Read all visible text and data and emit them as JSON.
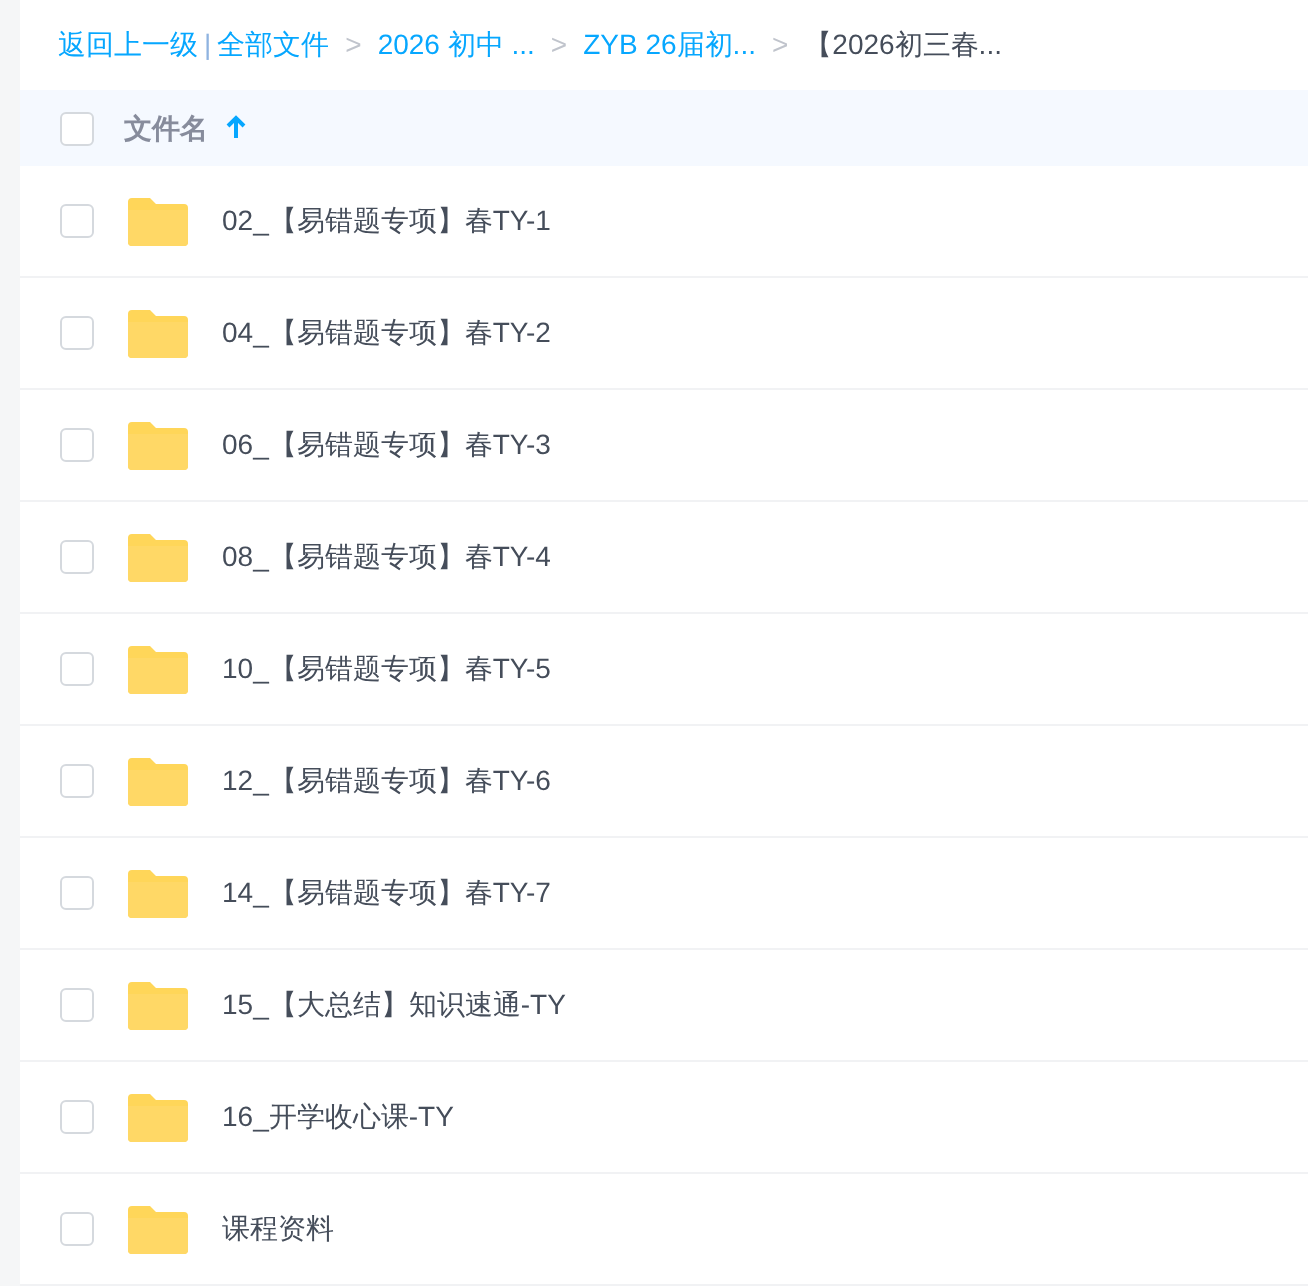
{
  "breadcrumb": {
    "back": "返回上一级",
    "separator": "|",
    "items": [
      {
        "label": "全部文件",
        "current": false
      },
      {
        "label": "2026 初中 ...",
        "current": false
      },
      {
        "label": "ZYB 26届初...",
        "current": false
      },
      {
        "label": "【2026初三春...",
        "current": true
      }
    ],
    "arrow": ">"
  },
  "header": {
    "checked": false,
    "column": "文件名",
    "sort_ascending": true
  },
  "rows": [
    {
      "name": "02_【易错题专项】春TY-1",
      "checked": false
    },
    {
      "name": "04_【易错题专项】春TY-2",
      "checked": false
    },
    {
      "name": "06_【易错题专项】春TY-3",
      "checked": false
    },
    {
      "name": "08_【易错题专项】春TY-4",
      "checked": false
    },
    {
      "name": "10_【易错题专项】春TY-5",
      "checked": false
    },
    {
      "name": "12_【易错题专项】春TY-6",
      "checked": false
    },
    {
      "name": "14_【易错题专项】春TY-7",
      "checked": false
    },
    {
      "name": "15_【大总结】知识速通-TY",
      "checked": false
    },
    {
      "name": "16_开学收心课-TY",
      "checked": false
    },
    {
      "name": "课程资料",
      "checked": false
    }
  ]
}
